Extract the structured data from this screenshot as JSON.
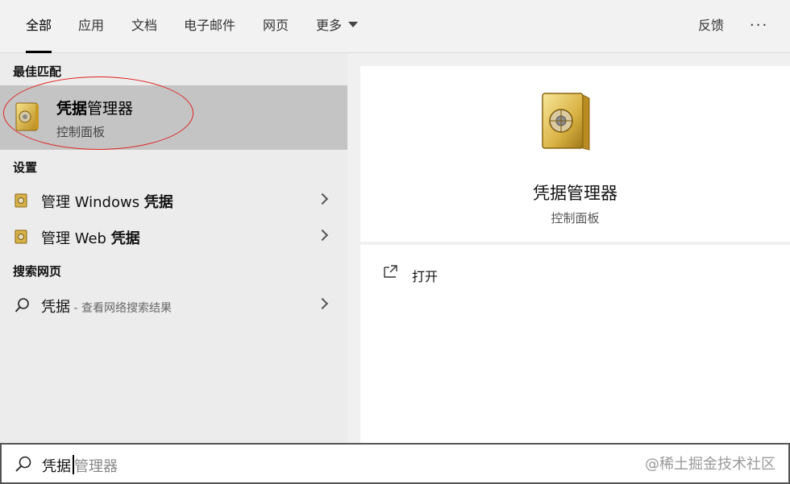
{
  "tabs": [
    {
      "label": "全部",
      "active": true
    },
    {
      "label": "应用"
    },
    {
      "label": "文档"
    },
    {
      "label": "电子邮件"
    },
    {
      "label": "网页"
    },
    {
      "label": "更多"
    }
  ],
  "top_right": {
    "feedback": "反馈",
    "more": "···"
  },
  "left": {
    "best_match_title": "最佳匹配",
    "best_match": {
      "name_bold": "凭据",
      "name_rest": "管理器",
      "subtitle": "控制面板",
      "icon": "safe-icon"
    },
    "settings_title": "设置",
    "settings_items": [
      {
        "label_pre": "管理 Windows ",
        "label_bold": "凭据",
        "icon": "credential-icon"
      },
      {
        "label_pre": "管理 Web ",
        "label_bold": "凭据",
        "icon": "credential-icon"
      }
    ],
    "web_title": "搜索网页",
    "web_item": {
      "label": "凭据",
      "hint": " - 查看网络搜索结果",
      "icon": "search-icon"
    }
  },
  "preview": {
    "title": "凭据管理器",
    "subtitle": "控制面板",
    "open_label": "打开"
  },
  "search": {
    "typed": "凭据",
    "ghost": "管理器",
    "watermark": "@稀土掘金技术社区"
  },
  "colors": {
    "highlight": "#c4c4c4",
    "annotation": "#e02020"
  }
}
